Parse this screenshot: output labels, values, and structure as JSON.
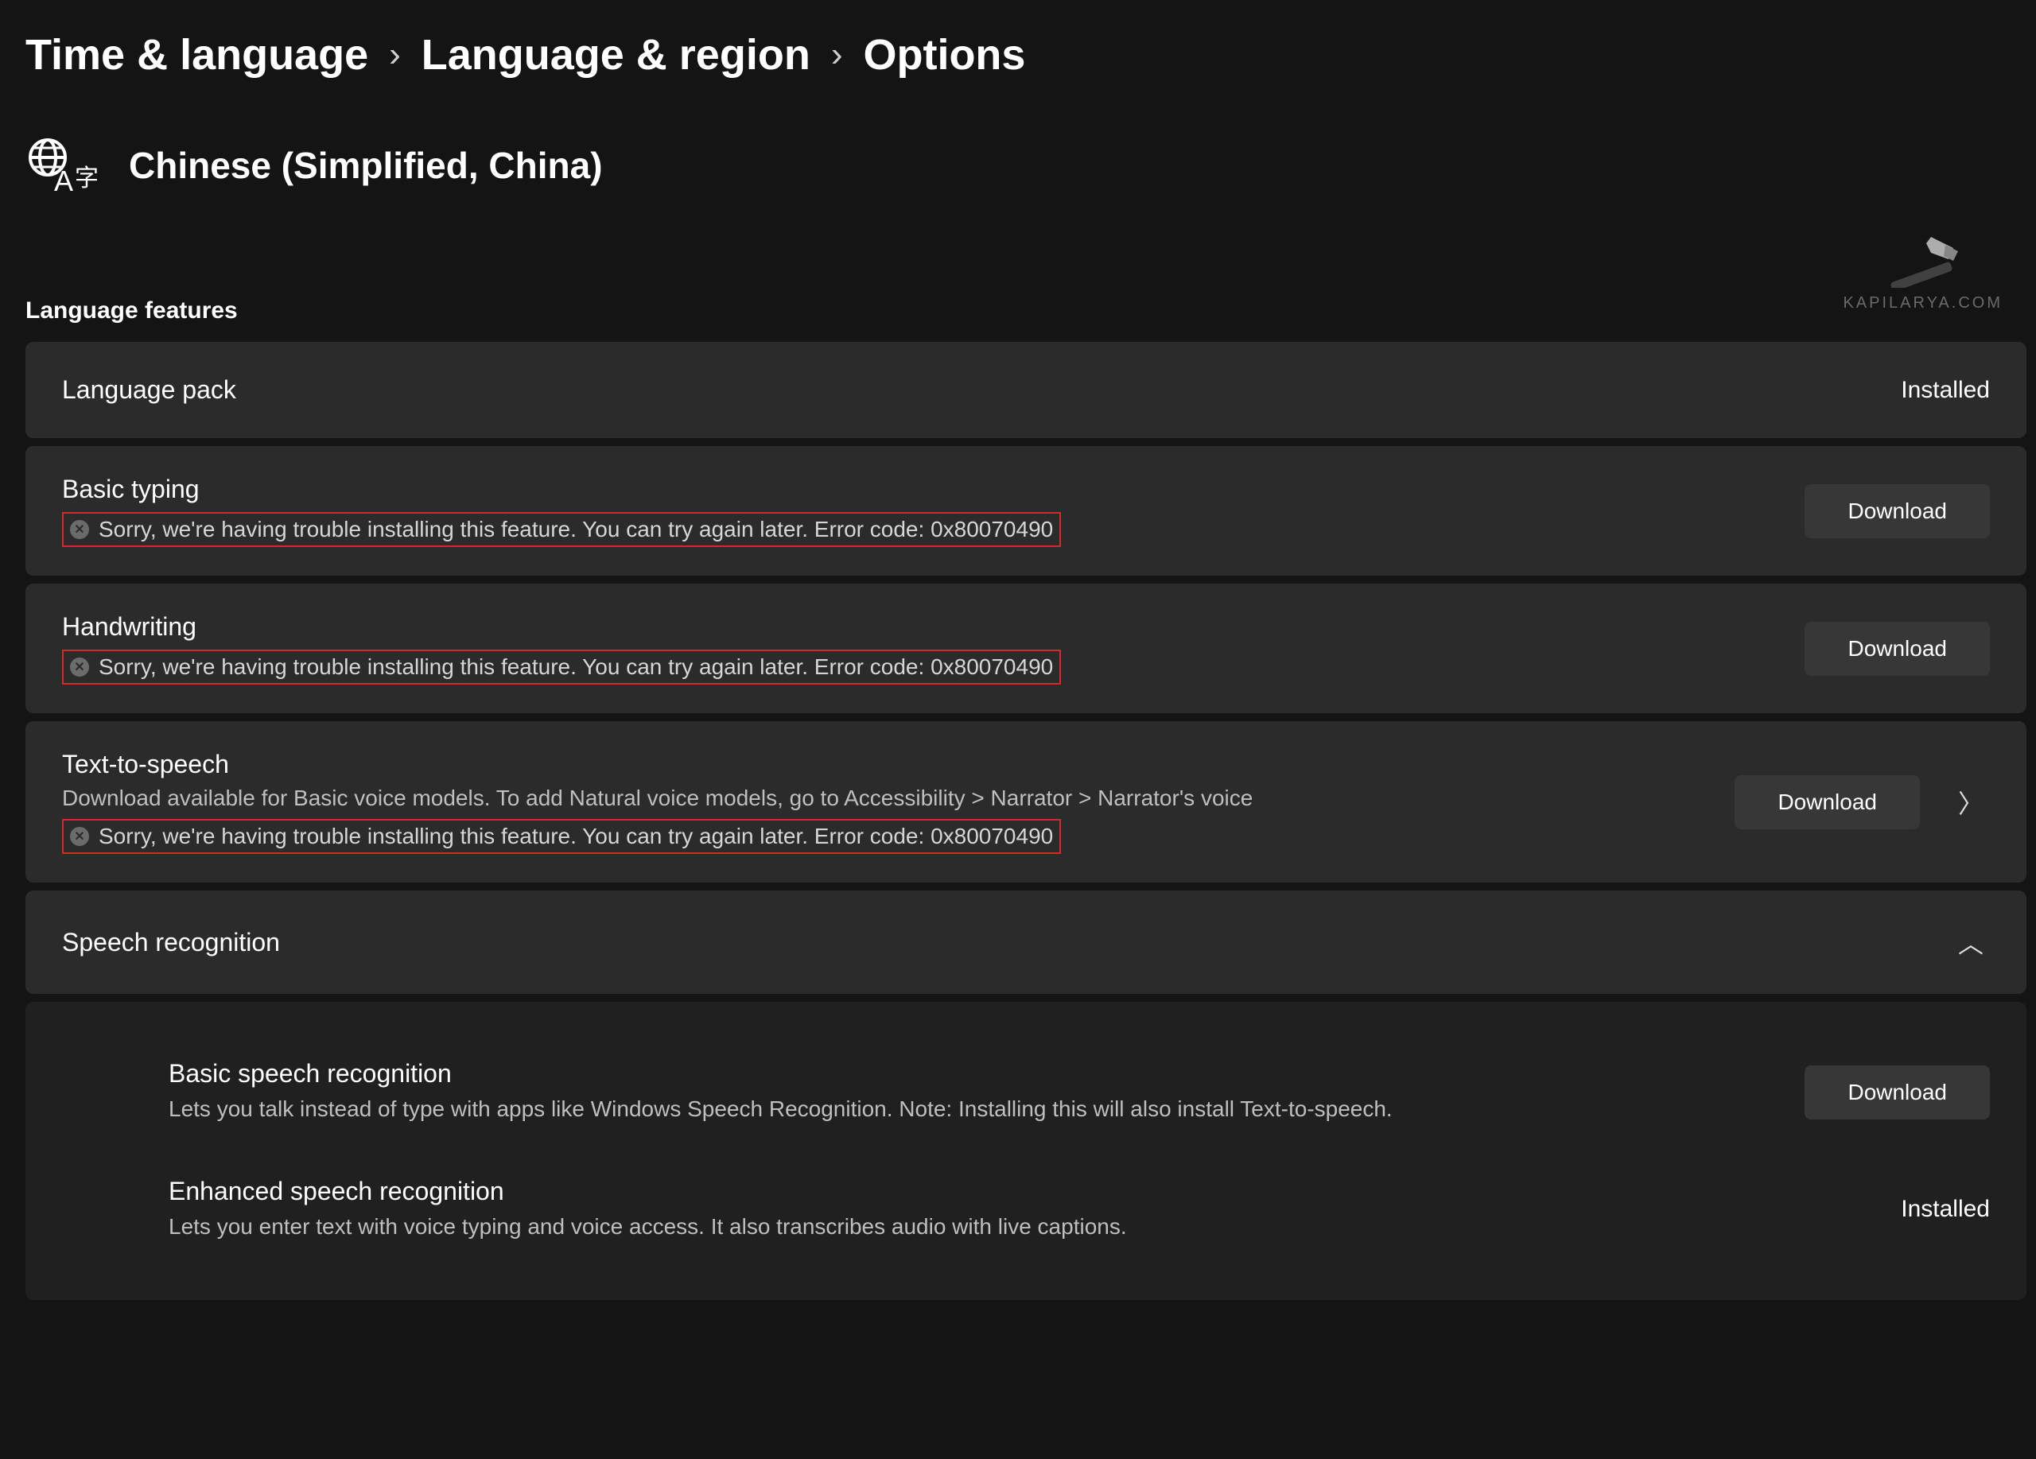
{
  "breadcrumb": {
    "item0": "Time & language",
    "item1": "Language & region",
    "current": "Options"
  },
  "language_title": "Chinese (Simplified, China)",
  "section_label": "Language features",
  "status": {
    "installed": "Installed"
  },
  "buttons": {
    "download": "Download"
  },
  "features": {
    "pack": {
      "title": "Language pack"
    },
    "typing": {
      "title": "Basic typing",
      "error": "Sorry, we're having trouble installing this feature. You can try again later. Error code: 0x80070490"
    },
    "handwriting": {
      "title": "Handwriting",
      "error": "Sorry, we're having trouble installing this feature. You can try again later. Error code: 0x80070490"
    },
    "tts": {
      "title": "Text-to-speech",
      "sub": "Download available for Basic voice models. To add Natural voice models, go to Accessibility > Narrator > Narrator's voice",
      "error": "Sorry, we're having trouble installing this feature. You can try again later. Error code: 0x80070490"
    },
    "speech": {
      "title": "Speech recognition",
      "items": {
        "basic": {
          "name": "Basic speech recognition",
          "desc": "Lets you talk instead of type with apps like Windows Speech Recognition. Note: Installing this will also install Text-to-speech."
        },
        "enhanced": {
          "name": "Enhanced speech recognition",
          "desc": "Lets you enter text with voice typing and voice access. It also transcribes audio with live captions."
        }
      }
    }
  },
  "watermark": "KAPILARYA.COM"
}
